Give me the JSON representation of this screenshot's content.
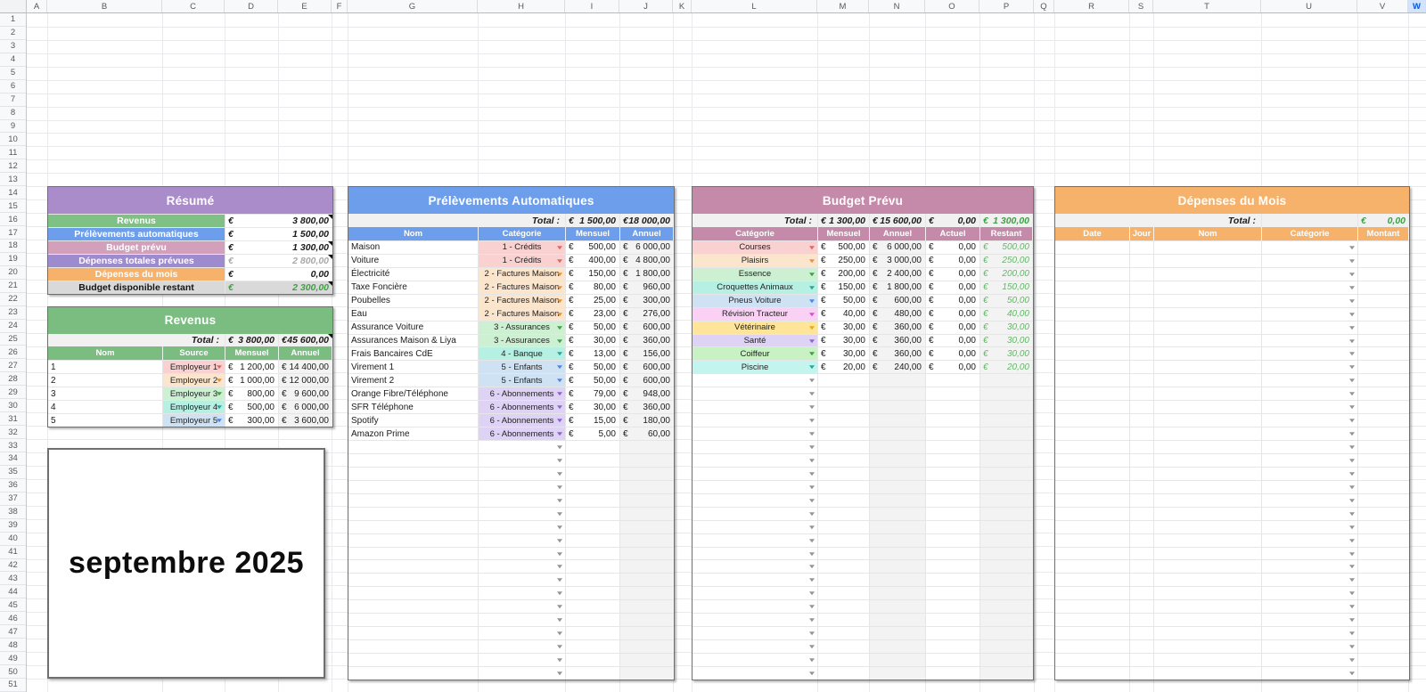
{
  "sheet": {
    "column_labels": [
      "A",
      "B",
      "C",
      "D",
      "E",
      "F",
      "G",
      "H",
      "I",
      "J",
      "K",
      "L",
      "M",
      "N",
      "O",
      "P",
      "Q",
      "R",
      "S",
      "T",
      "U",
      "V",
      "W"
    ],
    "selected_column": "W",
    "rows_visible": 51,
    "currency_symbol": "€",
    "month_label": "septembre 2025"
  },
  "colors": {
    "header_purple": "#a98cc9",
    "header_green": "#7bbd80",
    "header_blue": "#6d9eeb",
    "header_mauve": "#c58aa9",
    "header_orange": "#f6b26b",
    "row_green": "#7fc084",
    "row_blue": "#6d9eeb",
    "row_pink": "#d2a0ba",
    "row_purple": "#9e8bcd",
    "row_orange": "#f6b26b",
    "row_gray": "#d9d9d9",
    "chip_red": "#f9d1d1",
    "chip_orange": "#fce5cd",
    "chip_green": "#cdf0d2",
    "chip_teal": "#b6f0e3",
    "chip_blue": "#cfe2f3",
    "chip_purple": "#ded2f5",
    "chip_magenta": "#fad1f4",
    "chip_yellow": "#ffe599",
    "chip_brightgreen": "#c8f2c4",
    "chip_cyan": "#c4f4ee",
    "arrow_red": "#e06666",
    "arrow_orange": "#e69138",
    "arrow_green": "#3fa045",
    "arrow_teal": "#26a69a",
    "arrow_blue": "#4a86e8",
    "arrow_purple": "#8e63ce",
    "arrow_magenta": "#d64fc8",
    "arrow_gold": "#deae16",
    "arrow_gray": "#8f959b",
    "value_green": "#3fa145",
    "restant_green": "#67b56b",
    "muted_gray": "#a9a9a9",
    "total_row_bg": "#f1f1f1",
    "gray_col_bg": "#f3f3f3"
  },
  "resume": {
    "title": "Résumé",
    "rows": [
      {
        "label": "Revenus",
        "value": "3 800,00",
        "color_key": "row_green",
        "note": true
      },
      {
        "label": "Prélèvements automatiques",
        "value": "1 500,00",
        "color_key": "row_blue"
      },
      {
        "label": "Budget prévu",
        "value": "1 300,00",
        "color_key": "row_pink",
        "note": true
      },
      {
        "label": "Dépenses totales prévues",
        "value": "2 800,00",
        "color_key": "row_purple",
        "muted": true,
        "note": true
      },
      {
        "label": "Dépenses du mois",
        "value": "0,00",
        "color_key": "row_orange"
      },
      {
        "label": "Budget disponible restant",
        "value": "2 300,00",
        "color_key": "row_gray",
        "positive": true,
        "note": true
      }
    ]
  },
  "revenus": {
    "title": "Revenus",
    "total_label": "Total :",
    "totals": {
      "mensuel": "3 800,00",
      "annuel": "45 600,00"
    },
    "headers": [
      "Nom",
      "Source",
      "Mensuel",
      "Annuel"
    ],
    "rows": [
      {
        "nom": "1",
        "source": "Employeur 1",
        "chip": "chip_red",
        "arrow": "arrow_red",
        "mensuel": "1 200,00",
        "annuel": "14 400,00"
      },
      {
        "nom": "2",
        "source": "Employeur 2",
        "chip": "chip_orange",
        "arrow": "arrow_orange",
        "mensuel": "1 000,00",
        "annuel": "12 000,00"
      },
      {
        "nom": "3",
        "source": "Employeur 3",
        "chip": "chip_green",
        "arrow": "arrow_green",
        "mensuel": "800,00",
        "annuel": "9 600,00"
      },
      {
        "nom": "4",
        "source": "Employeur 4",
        "chip": "chip_teal",
        "arrow": "arrow_teal",
        "mensuel": "500,00",
        "annuel": "6 000,00"
      },
      {
        "nom": "5",
        "source": "Employeur 5",
        "chip": "chip_blue",
        "arrow": "arrow_blue",
        "mensuel": "300,00",
        "annuel": "3 600,00"
      }
    ]
  },
  "prelevements": {
    "title": "Prélèvements Automatiques",
    "total_label": "Total :",
    "totals": {
      "mensuel": "1 500,00",
      "annuel": "18 000,00"
    },
    "headers": [
      "Nom",
      "Catégorie",
      "Mensuel",
      "Annuel"
    ],
    "rows": [
      {
        "nom": "Maison",
        "categorie": "1 - Crédits",
        "chip": "chip_red",
        "arrow": "arrow_red",
        "mensuel": "500,00",
        "annuel": "6 000,00"
      },
      {
        "nom": "Voiture",
        "categorie": "1 - Crédits",
        "chip": "chip_red",
        "arrow": "arrow_red",
        "mensuel": "400,00",
        "annuel": "4 800,00"
      },
      {
        "nom": "Électricité",
        "categorie": "2 - Factures Maison",
        "chip": "chip_orange",
        "arrow": "arrow_orange",
        "mensuel": "150,00",
        "annuel": "1 800,00"
      },
      {
        "nom": "Taxe Foncière",
        "categorie": "2 - Factures Maison",
        "chip": "chip_orange",
        "arrow": "arrow_orange",
        "mensuel": "80,00",
        "annuel": "960,00"
      },
      {
        "nom": "Poubelles",
        "categorie": "2 - Factures Maison",
        "chip": "chip_orange",
        "arrow": "arrow_orange",
        "mensuel": "25,00",
        "annuel": "300,00"
      },
      {
        "nom": "Eau",
        "categorie": "2 - Factures Maison",
        "chip": "chip_orange",
        "arrow": "arrow_orange",
        "mensuel": "23,00",
        "annuel": "276,00"
      },
      {
        "nom": "Assurance Voiture",
        "categorie": "3 - Assurances",
        "chip": "chip_green",
        "arrow": "arrow_green",
        "mensuel": "50,00",
        "annuel": "600,00"
      },
      {
        "nom": "Assurances Maison & Liya",
        "categorie": "3 - Assurances",
        "chip": "chip_green",
        "arrow": "arrow_green",
        "mensuel": "30,00",
        "annuel": "360,00"
      },
      {
        "nom": "Frais Bancaires CdE",
        "categorie": "4 - Banque",
        "chip": "chip_teal",
        "arrow": "arrow_teal",
        "mensuel": "13,00",
        "annuel": "156,00"
      },
      {
        "nom": "Virement 1",
        "categorie": "5 - Enfants",
        "chip": "chip_blue",
        "arrow": "arrow_blue",
        "mensuel": "50,00",
        "annuel": "600,00"
      },
      {
        "nom": "Virement 2",
        "categorie": "5 - Enfants",
        "chip": "chip_blue",
        "arrow": "arrow_blue",
        "mensuel": "50,00",
        "annuel": "600,00"
      },
      {
        "nom": "Orange Fibre/Téléphone",
        "categorie": "6 - Abonnements",
        "chip": "chip_purple",
        "arrow": "arrow_purple",
        "mensuel": "79,00",
        "annuel": "948,00"
      },
      {
        "nom": "SFR Téléphone",
        "categorie": "6 - Abonnements",
        "chip": "chip_purple",
        "arrow": "arrow_purple",
        "mensuel": "30,00",
        "annuel": "360,00"
      },
      {
        "nom": "Spotify",
        "categorie": "6 - Abonnements",
        "chip": "chip_purple",
        "arrow": "arrow_purple",
        "mensuel": "15,00",
        "annuel": "180,00"
      },
      {
        "nom": "Amazon Prime",
        "categorie": "6 - Abonnements",
        "chip": "chip_purple",
        "arrow": "arrow_purple",
        "mensuel": "5,00",
        "annuel": "60,00"
      }
    ],
    "empty_rows": 18
  },
  "budget": {
    "title": "Budget Prévu",
    "total_label": "Total :",
    "totals": {
      "mensuel": "1 300,00",
      "annuel": "15 600,00",
      "actuel": "0,00",
      "restant": "1 300,00"
    },
    "headers": [
      "Catégorie",
      "Mensuel",
      "Annuel",
      "Actuel",
      "Restant"
    ],
    "rows": [
      {
        "categorie": "Courses",
        "chip": "chip_red",
        "arrow": "arrow_red",
        "mensuel": "500,00",
        "annuel": "6 000,00",
        "actuel": "0,00",
        "restant": "500,00"
      },
      {
        "categorie": "Plaisirs",
        "chip": "chip_orange",
        "arrow": "arrow_orange",
        "mensuel": "250,00",
        "annuel": "3 000,00",
        "actuel": "0,00",
        "restant": "250,00"
      },
      {
        "categorie": "Essence",
        "chip": "chip_green",
        "arrow": "arrow_green",
        "mensuel": "200,00",
        "annuel": "2 400,00",
        "actuel": "0,00",
        "restant": "200,00"
      },
      {
        "categorie": "Croquettes Animaux",
        "chip": "chip_teal",
        "arrow": "arrow_teal",
        "mensuel": "150,00",
        "annuel": "1 800,00",
        "actuel": "0,00",
        "restant": "150,00"
      },
      {
        "categorie": "Pneus Voiture",
        "chip": "chip_blue",
        "arrow": "arrow_blue",
        "mensuel": "50,00",
        "annuel": "600,00",
        "actuel": "0,00",
        "restant": "50,00"
      },
      {
        "categorie": "Révision Tracteur",
        "chip": "chip_magenta",
        "arrow": "arrow_magenta",
        "mensuel": "40,00",
        "annuel": "480,00",
        "actuel": "0,00",
        "restant": "40,00"
      },
      {
        "categorie": "Vétérinaire",
        "chip": "chip_yellow",
        "arrow": "arrow_gold",
        "mensuel": "30,00",
        "annuel": "360,00",
        "actuel": "0,00",
        "restant": "30,00"
      },
      {
        "categorie": "Santé",
        "chip": "chip_purple",
        "arrow": "arrow_purple",
        "mensuel": "30,00",
        "annuel": "360,00",
        "actuel": "0,00",
        "restant": "30,00"
      },
      {
        "categorie": "Coiffeur",
        "chip": "chip_brightgreen",
        "arrow": "arrow_green",
        "mensuel": "30,00",
        "annuel": "360,00",
        "actuel": "0,00",
        "restant": "30,00"
      },
      {
        "categorie": "Piscine",
        "chip": "chip_cyan",
        "arrow": "arrow_teal",
        "mensuel": "20,00",
        "annuel": "240,00",
        "actuel": "0,00",
        "restant": "20,00"
      }
    ],
    "empty_rows": 23
  },
  "depenses": {
    "title": "Dépenses du Mois",
    "total_label": "Total :",
    "totals": {
      "montant": "0,00"
    },
    "headers": [
      "Date",
      "Jour",
      "Nom",
      "Catégorie",
      "Montant"
    ],
    "empty_rows": 33
  }
}
